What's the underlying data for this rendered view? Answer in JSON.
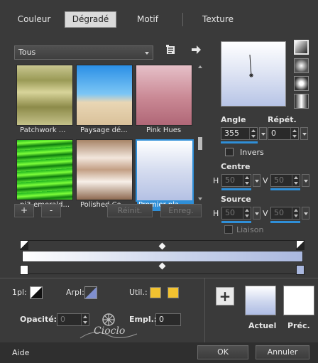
{
  "tabs": [
    {
      "label": "Couleur"
    },
    {
      "label": "Dégradé"
    },
    {
      "label": "Motif"
    },
    {
      "label": "Texture"
    }
  ],
  "filter": {
    "selected": "Tous"
  },
  "gallery": {
    "items": [
      {
        "label": "Patchwork ..."
      },
      {
        "label": "Paysage dé..."
      },
      {
        "label": "Pink Hues"
      },
      {
        "label": "pj3-emerald..."
      },
      {
        "label": "Polished Co..."
      },
      {
        "label": "Premier pla..."
      }
    ]
  },
  "buttons": {
    "add": "+",
    "remove": "-",
    "reset": "Réinit.",
    "save": "Enreg."
  },
  "params": {
    "angle_label": "Angle",
    "angle_value": "355",
    "repeat_label": "Répét.",
    "repeat_value": "0",
    "invert_label": "Invers",
    "center_label": "Centre",
    "center_h_label": "H",
    "center_h_value": "50",
    "center_v_label": "V",
    "center_v_value": "50",
    "source_label": "Source",
    "source_h_label": "H",
    "source_h_value": "50",
    "source_v_label": "V",
    "source_v_value": "50",
    "link_label": "Liaison"
  },
  "editor": {
    "first_label": "1pl:",
    "arpl_label": "Arpl:",
    "util_label": "Util.:",
    "opacity_label": "Opacité:",
    "opacity_value": "0",
    "empl_label": "Empl.:",
    "empl_value": "0"
  },
  "colors": {
    "current_label": "Actuel",
    "previous_label": "Préc.",
    "accent": "#2f8fd8",
    "swatch_yellow": "#f2c230"
  },
  "watermark": "Cioclo",
  "footer": {
    "help": "Aide",
    "ok": "OK",
    "cancel": "Annuler"
  }
}
